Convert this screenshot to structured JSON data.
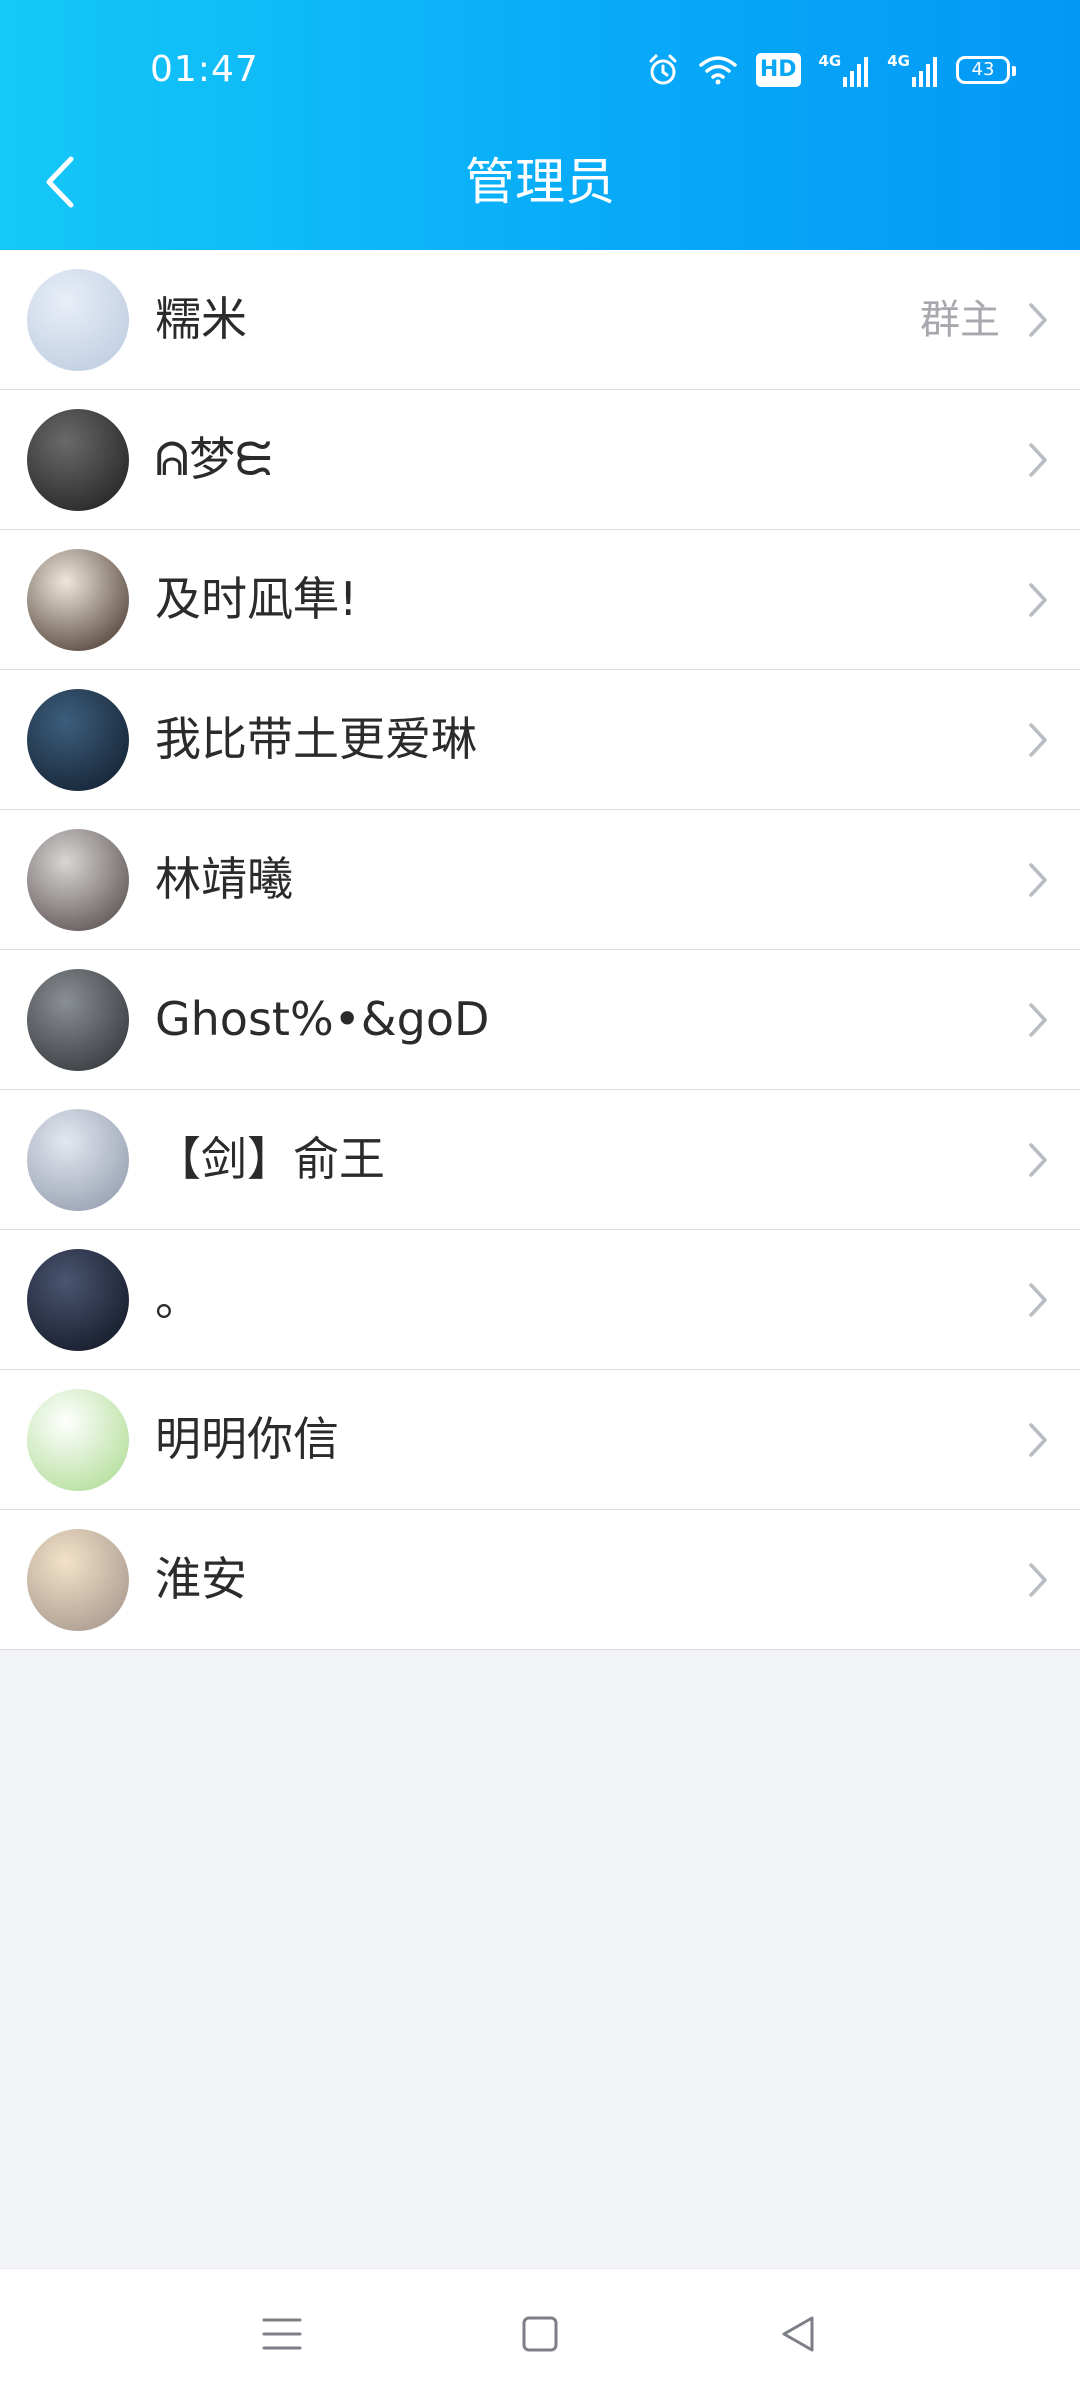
{
  "status_bar": {
    "time": "01:47",
    "hd_label": "HD",
    "network_1": "4G",
    "network_2": "4G",
    "battery": "43",
    "icons": [
      "alarm-icon",
      "wifi-icon",
      "hd-icon",
      "signal-icon",
      "signal-icon",
      "battery-icon"
    ]
  },
  "header": {
    "title": "管理员",
    "back_icon": "back-arrow-icon",
    "gradient": [
      "#15c8f8",
      "#0398f6"
    ]
  },
  "members": [
    {
      "name": "糯米",
      "role": "群主",
      "avatar_colors": [
        "#e8eef7",
        "#b9c9de"
      ]
    },
    {
      "name": "ᕱ梦ᙓ",
      "role": "",
      "avatar_colors": [
        "#6a6a6a",
        "#1b1b1b"
      ]
    },
    {
      "name": "及时凪隼!",
      "role": "",
      "avatar_colors": [
        "#efe7dc",
        "#3a2a20"
      ]
    },
    {
      "name": "我比带土更爱琳",
      "role": "",
      "avatar_colors": [
        "#3d5e7c",
        "#0f1b2a"
      ]
    },
    {
      "name": "林靖曦",
      "role": "",
      "avatar_colors": [
        "#d9d6d6",
        "#4b4040"
      ]
    },
    {
      "name": "Ghost%•&goD",
      "role": "",
      "avatar_colors": [
        "#8a8f94",
        "#2a2d31"
      ]
    },
    {
      "name": "【剑】俞王",
      "role": "",
      "avatar_colors": [
        "#e3e7ef",
        "#8b95a8"
      ]
    },
    {
      "name": "。",
      "role": "",
      "avatar_colors": [
        "#4a5570",
        "#0d1220"
      ]
    },
    {
      "name": "明明你信",
      "role": "",
      "avatar_colors": [
        "#ffffff",
        "#a7d98a"
      ]
    },
    {
      "name": "淮安",
      "role": "",
      "avatar_colors": [
        "#f3e2c8",
        "#9d8f86"
      ]
    }
  ],
  "colors": {
    "accent": "#0aa7f4",
    "chevron": "#b8bcc4",
    "role_text": "#a7a7ad",
    "name_text": "#2b2b2b",
    "page_bg": "#f2f3f7"
  },
  "navbar": {
    "icons": [
      "menu-icon",
      "home-icon",
      "back-icon"
    ]
  }
}
